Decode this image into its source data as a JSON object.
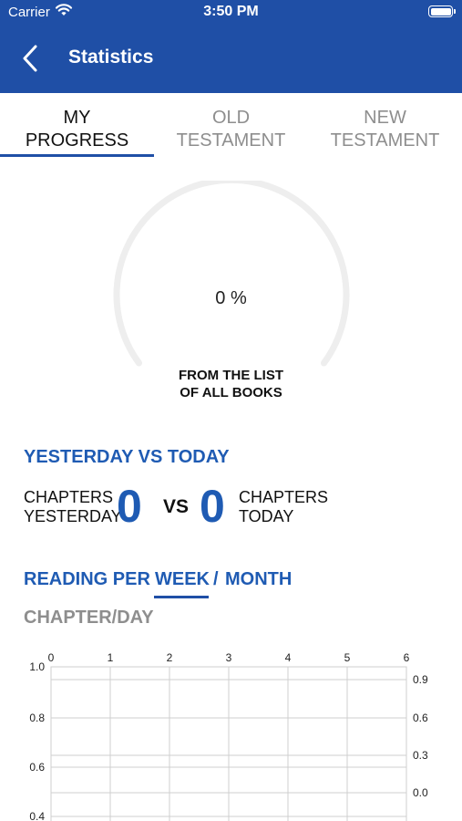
{
  "status_bar": {
    "carrier": "Carrier",
    "time": "3:50 PM"
  },
  "nav": {
    "title": "Statistics",
    "back_icon": "chevron-left-icon"
  },
  "tabs": [
    {
      "line1": "MY",
      "line2": "PROGRESS",
      "active": true
    },
    {
      "line1": "OLD",
      "line2": "TESTAMENT",
      "active": false
    },
    {
      "line1": "NEW",
      "line2": "TESTAMENT",
      "active": false
    }
  ],
  "progress": {
    "percent_text": "0 %",
    "percent_value": 0,
    "caption_line1": "FROM THE LIST",
    "caption_line2": "OF ALL BOOKS"
  },
  "comparison": {
    "title": "YESTERDAY VS TODAY",
    "yesterday_label_line1": "CHAPTERS",
    "yesterday_label_line2": "YESTERDAY",
    "yesterday_value": "0",
    "vs": "VS",
    "today_value": "0",
    "today_label_line1": "CHAPTERS",
    "today_label_line2": "TODAY"
  },
  "reading": {
    "label_prefix": "READING PER",
    "tab_week": "WEEK",
    "separator": "/",
    "tab_month": "MONTH",
    "active_tab": "WEEK"
  },
  "chart_data": {
    "type": "line",
    "title": "CHAPTER/DAY",
    "x_ticks": [
      "0",
      "1",
      "2",
      "3",
      "4",
      "5",
      "6"
    ],
    "xlim": [
      0,
      6
    ],
    "y_left_ticks": [
      "1.0",
      "0.8",
      "0.6",
      "0.4"
    ],
    "y_right_ticks": [
      "0.9",
      "0.6",
      "0.3",
      "0.0"
    ],
    "grid": true,
    "series": []
  },
  "colors": {
    "brand": "#1f4fa6",
    "accent": "#1f5bb3",
    "muted": "#8e8e8e",
    "gauge_track": "#eeeeee"
  }
}
